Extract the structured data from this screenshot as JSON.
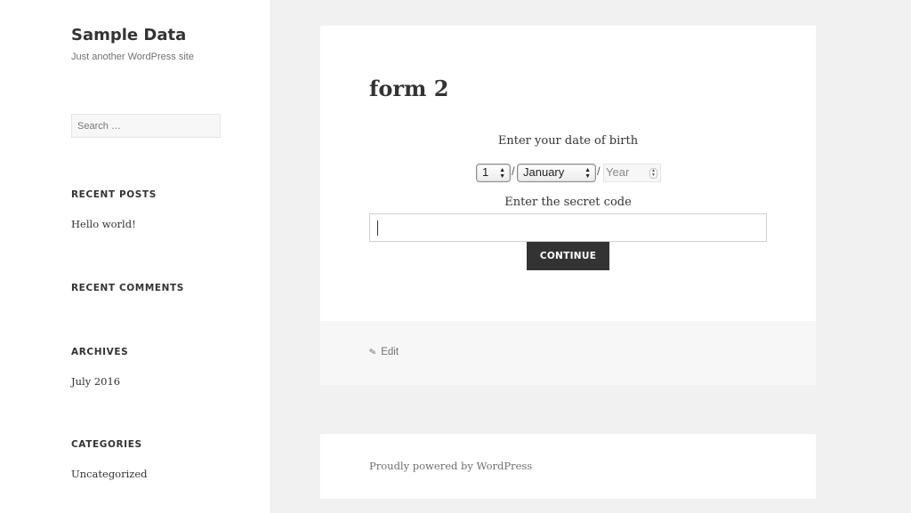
{
  "site": {
    "title": "Sample Data",
    "description": "Just another WordPress site"
  },
  "sidebar": {
    "search_placeholder": "Search …",
    "widgets": {
      "recent_posts": {
        "title": "RECENT POSTS",
        "items": [
          "Hello world!"
        ]
      },
      "recent_comments": {
        "title": "RECENT COMMENTS"
      },
      "archives": {
        "title": "ARCHIVES",
        "items": [
          "July 2016"
        ]
      },
      "categories": {
        "title": "CATEGORIES",
        "items": [
          "Uncategorized"
        ]
      }
    }
  },
  "entry": {
    "title": "form 2",
    "dob_label": "Enter your date of birth",
    "day_value": "1",
    "month_value": "January",
    "separator": "/",
    "year_placeholder": "Year",
    "code_label": "Enter the secret code",
    "code_value": "",
    "continue_label": "CONTINUE",
    "edit_label": "Edit"
  },
  "footer": {
    "powered_by": "Proudly powered by WordPress"
  },
  "icons": {
    "pencil": "pencil-icon",
    "select_arrows": "updown-arrows-icon",
    "spinner": "spinner-icon"
  },
  "colors": {
    "background": "#f1f1f1",
    "button": "#333333",
    "text": "#333333",
    "muted": "#707070"
  }
}
